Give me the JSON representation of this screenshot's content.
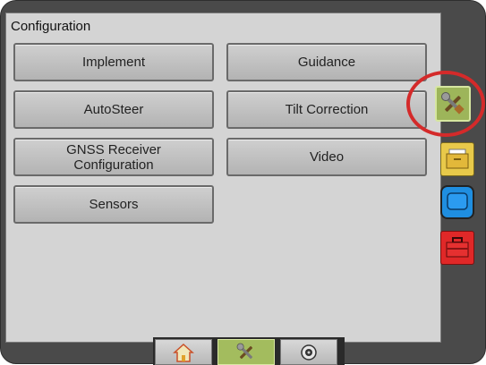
{
  "panel": {
    "title": "Configuration"
  },
  "buttons": {
    "implement": "Implement",
    "guidance": "Guidance",
    "autosteer": "AutoSteer",
    "tilt_correction": "Tilt Correction",
    "gnss_line1": "GNSS Receiver",
    "gnss_line2": "Configuration",
    "video": "Video",
    "sensors": "Sensors"
  },
  "sidebar": {
    "tabs": [
      {
        "icon": "tools-icon",
        "active": true
      },
      {
        "icon": "folder-icon",
        "active": false
      },
      {
        "icon": "screen-icon",
        "active": false
      },
      {
        "icon": "toolbox-icon",
        "active": false
      }
    ]
  },
  "bottom_nav": {
    "tabs": [
      {
        "icon": "home-icon",
        "active": false
      },
      {
        "icon": "tools-icon",
        "active": true
      },
      {
        "icon": "camera-icon",
        "active": false
      }
    ]
  },
  "colors": {
    "highlight_ring": "#d42a2a",
    "active_tab": "#9db55a",
    "panel_bg": "#d4d4d4"
  }
}
